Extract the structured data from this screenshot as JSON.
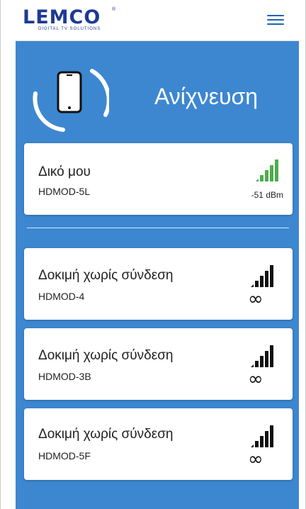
{
  "header": {
    "logo_text": "LEMCO",
    "logo_registered": "®",
    "logo_subtitle": "DIGITAL TV SOLUTIONS",
    "menu_icon": "hamburger-menu-icon"
  },
  "scan": {
    "icon": "phone-scan-icon",
    "title": "Ανίχνευση"
  },
  "my_device": {
    "name": "Δικό μου",
    "model": "HDMOD-5L",
    "signal_text": "-51 dBm",
    "signal_color": "#4cae4c",
    "signal_icon": "signal-strength-icon"
  },
  "devices": [
    {
      "name": "Δοκιμή χωρίς σύνδεση",
      "model": "HDMOD-4",
      "signal_symbol": "∞"
    },
    {
      "name": "Δοκιμή χωρίς σύνδεση",
      "model": "HDMOD-3B",
      "signal_symbol": "∞"
    },
    {
      "name": "Δοκιμή χωρίς σύνδεση",
      "model": "HDMOD-5F",
      "signal_symbol": "∞"
    }
  ],
  "colors": {
    "primary_blue": "#3d87d1",
    "logo_blue": "#1f3a93",
    "card_bg": "#ffffff"
  }
}
